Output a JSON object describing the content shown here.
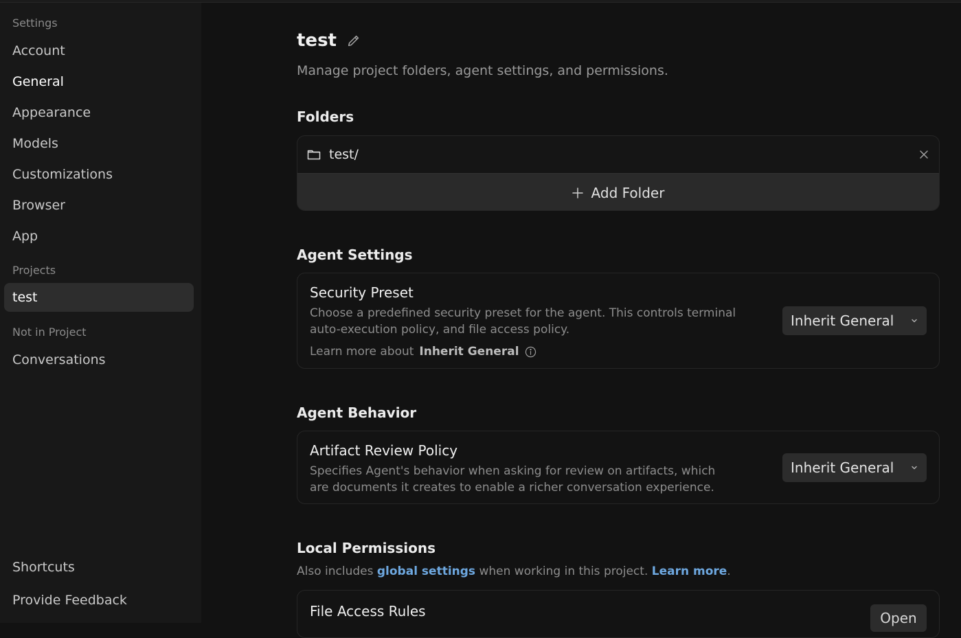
{
  "sidebar": {
    "settings_header": "Settings",
    "items": [
      {
        "label": "Account"
      },
      {
        "label": "General"
      },
      {
        "label": "Appearance"
      },
      {
        "label": "Models"
      },
      {
        "label": "Customizations"
      },
      {
        "label": "Browser"
      },
      {
        "label": "App"
      }
    ],
    "projects_header": "Projects",
    "project_items": [
      {
        "label": "test"
      }
    ],
    "not_in_project_header": "Not in Project",
    "other_items": [
      {
        "label": "Conversations"
      }
    ],
    "footer_items": [
      {
        "label": "Shortcuts"
      },
      {
        "label": "Provide Feedback"
      }
    ]
  },
  "page": {
    "title": "test",
    "subtitle": "Manage project folders, agent settings, and permissions."
  },
  "folders": {
    "heading": "Folders",
    "items": [
      {
        "name": "test/"
      }
    ],
    "add_label": "Add Folder"
  },
  "agent_settings": {
    "heading": "Agent Settings",
    "security_preset": {
      "title": "Security Preset",
      "description": "Choose a predefined security preset for the agent. This controls terminal auto-execution policy, and file access policy.",
      "learn_more_prefix": "Learn more about",
      "learn_more_target": "Inherit General",
      "value": "Inherit General"
    }
  },
  "agent_behavior": {
    "heading": "Agent Behavior",
    "artifact_review": {
      "title": "Artifact Review Policy",
      "description": "Specifies Agent's behavior when asking for review on artifacts, which are documents it creates to enable a richer conversation experience.",
      "value": "Inherit General"
    }
  },
  "local_permissions": {
    "heading": "Local Permissions",
    "desc_prefix": "Also includes",
    "global_link": "global settings",
    "desc_middle": "when working in this project.",
    "learn_more_link": "Learn more",
    "desc_suffix": ".",
    "file_access": {
      "title": "File Access Rules",
      "button": "Open"
    }
  },
  "colors": {
    "background": "#121212",
    "sidebar": "#181818",
    "link": "#6ea8e0"
  }
}
